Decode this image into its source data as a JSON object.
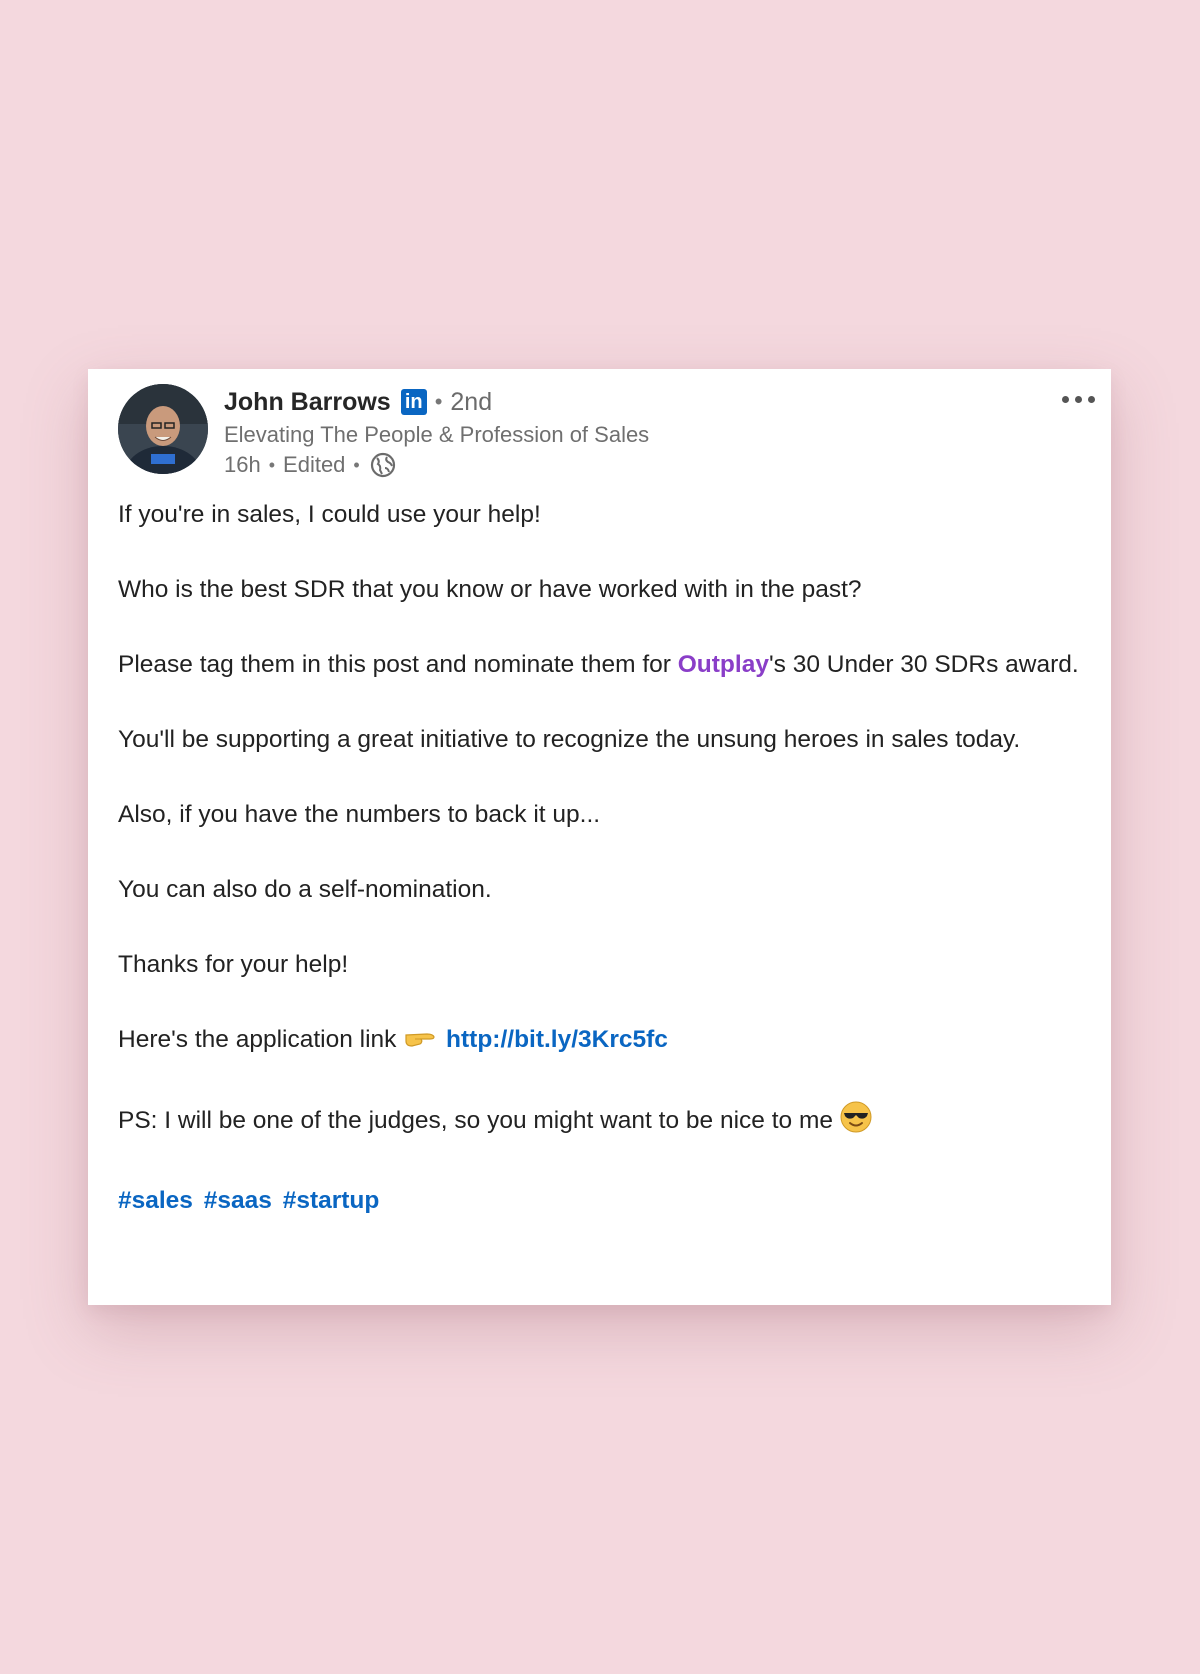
{
  "post": {
    "author": {
      "name": "John Barrows",
      "badge": "in",
      "degree": "2nd",
      "headline": "Elevating The People & Profession of Sales",
      "time": "16h",
      "edited": "Edited"
    },
    "body": {
      "p1": "If you're in sales, I could use your help!",
      "p2": "Who is the best SDR that you know or have worked with in the past?",
      "p3_before": "Please tag them in this post and nominate them for ",
      "p3_mention": "Outplay",
      "p3_after": "'s 30 Under 30 SDRs award.",
      "p4": "You'll be supporting a great initiative to recognize the unsung heroes in sales today.",
      "p5": "Also, if you have the numbers to back it up...",
      "p6": "You can also do a self-nomination.",
      "p7": "Thanks for your help!",
      "p8_before": "Here's the application link ",
      "p8_link": "http://bit.ly/3Krc5fc",
      "p9": "PS: I will be one of the judges, so you might want to be nice to me "
    },
    "hashtags": [
      "#sales",
      "#saas",
      "#startup"
    ],
    "icons": {
      "more": "more-horizontal-icon",
      "visibility": "globe-icon",
      "pointing": "backhand-index-pointing-right-emoji",
      "sunglasses": "smiling-face-with-sunglasses-emoji"
    },
    "colors": {
      "background": "#f4d8de",
      "link": "#0a66c2",
      "mention": "#8a3ec8"
    }
  }
}
